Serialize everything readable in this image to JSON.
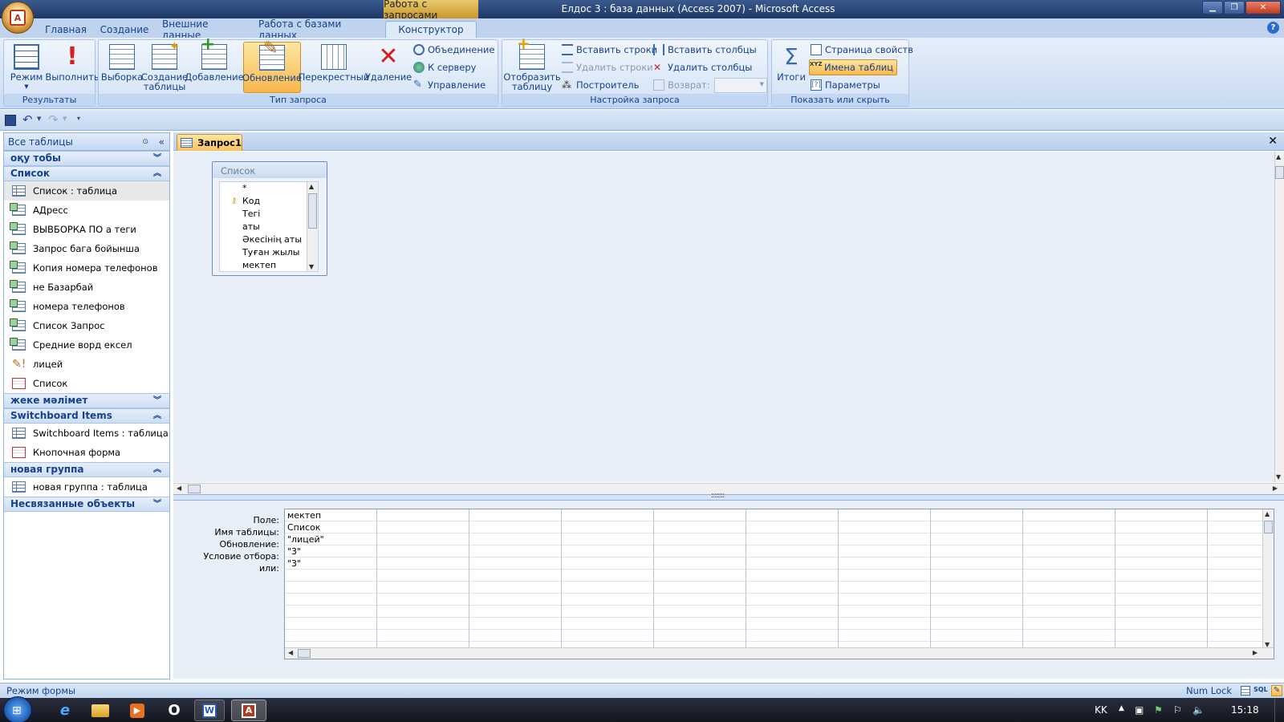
{
  "window": {
    "context_tab": "Работа с запросами",
    "title": "Елдос 3 : база данных (Access 2007) - Microsoft Access"
  },
  "ribbon_tabs": [
    "Главная",
    "Создание",
    "Внешние данные",
    "Работа с базами данных",
    "Конструктор"
  ],
  "ribbon": {
    "results": {
      "label": "Результаты",
      "mode": "Режим",
      "run": "Выполнить"
    },
    "query_type": {
      "label": "Тип запроса",
      "select": "Выборка",
      "make_table_1": "Создание",
      "make_table_2": "таблицы",
      "append": "Добавление",
      "update": "Обновление",
      "crosstab": "Перекрестный",
      "delete": "Удаление",
      "union": "Объединение",
      "to_server": "К серверу",
      "manage": "Управление"
    },
    "query_setup": {
      "label": "Настройка запроса",
      "show_table_1": "Отобразить",
      "show_table_2": "таблицу",
      "insert_rows": "Вставить строки",
      "delete_rows": "Удалить строки",
      "builder": "Построитель",
      "insert_columns": "Вставить столбцы",
      "delete_columns": "Удалить столбцы",
      "return": "Возврат:"
    },
    "show_hide": {
      "label": "Показать или скрыть",
      "totals": "Итоги",
      "property_sheet": "Страница свойств",
      "table_names": "Имена таблиц",
      "parameters": "Параметры"
    }
  },
  "nav": {
    "header": "Все таблицы",
    "groups": [
      {
        "title": "оқу тобы",
        "items": []
      },
      {
        "title": "Список",
        "items": [
          {
            "label": "Список : таблица",
            "type": "table"
          },
          {
            "label": "АДресс",
            "type": "query"
          },
          {
            "label": "ВЫВБОРКА  ПО а теги",
            "type": "query"
          },
          {
            "label": "Запрос бага бойынша",
            "type": "query"
          },
          {
            "label": "Копия номера телефонов",
            "type": "query"
          },
          {
            "label": "не Базарбай",
            "type": "query"
          },
          {
            "label": "номера телефонов",
            "type": "query"
          },
          {
            "label": "Список Запрос",
            "type": "query"
          },
          {
            "label": "Средние ворд ексел",
            "type": "query"
          },
          {
            "label": "лицей",
            "type": "update"
          },
          {
            "label": "Список",
            "type": "form"
          }
        ]
      },
      {
        "title": "жеке мәлімет",
        "items": []
      },
      {
        "title": "Switchboard Items",
        "items": [
          {
            "label": "Switchboard Items : таблица",
            "type": "table"
          },
          {
            "label": "Кнопочная форма",
            "type": "form"
          }
        ]
      },
      {
        "title": "новая группа",
        "items": [
          {
            "label": "новая группа : таблица",
            "type": "table"
          }
        ]
      },
      {
        "title": "Несвязанные объекты",
        "items": []
      }
    ]
  },
  "document": {
    "tab": "Запрос1",
    "table_box": {
      "title": "Список",
      "fields": [
        "*",
        "Код",
        "Тегі",
        "аты",
        "Әкесінің аты",
        "Туған жылы",
        "мектеп"
      ]
    },
    "grid": {
      "row_labels": [
        "Поле:",
        "Имя таблицы:",
        "Обновление:",
        "Условие отбора:",
        "или:"
      ],
      "col1": [
        "мектеп",
        "Список",
        "\"лицей\"",
        "\"3\"",
        "\"3\""
      ]
    }
  },
  "status": {
    "mode": "Режим формы",
    "numlock": "Num Lock",
    "sql": "SQL"
  },
  "taskbar": {
    "lang": "KK",
    "time": "15:18"
  }
}
